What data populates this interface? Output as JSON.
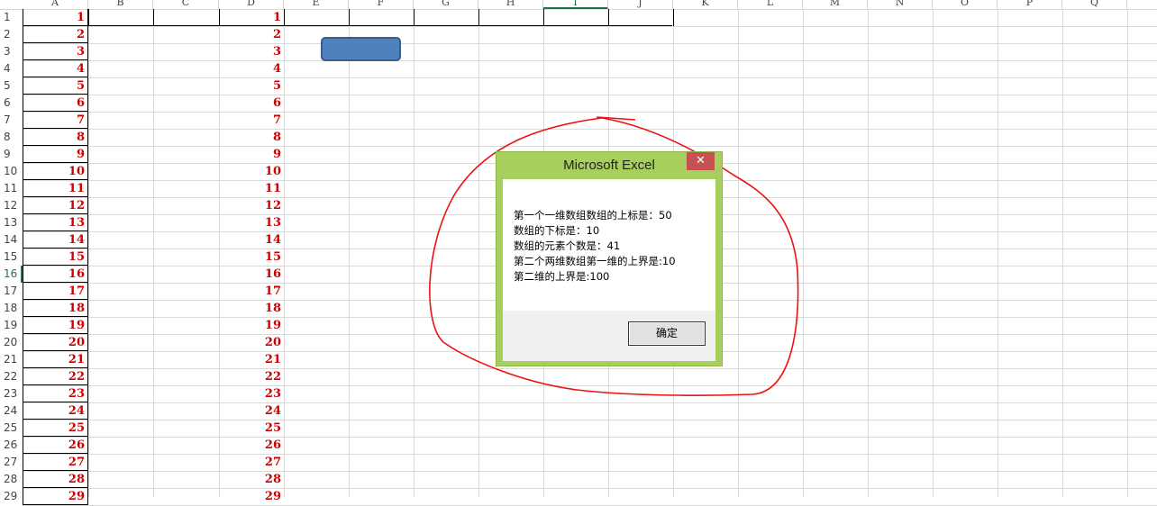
{
  "spreadsheet": {
    "columns": [
      "A",
      "B",
      "C",
      "D",
      "E",
      "F",
      "G",
      "H",
      "I",
      "J",
      "K",
      "L",
      "M",
      "N",
      "O",
      "P",
      "Q"
    ],
    "active_column": "I",
    "row_numbers": [
      "1",
      "2",
      "3",
      "4",
      "5",
      "6",
      "7",
      "8",
      "9",
      "10",
      "11",
      "12",
      "13",
      "14",
      "15",
      "16",
      "17",
      "18",
      "19",
      "20",
      "21",
      "22",
      "23",
      "24",
      "25",
      "26",
      "27",
      "28",
      "29"
    ],
    "active_row": "16",
    "column_a_values": [
      "1",
      "2",
      "3",
      "4",
      "5",
      "6",
      "7",
      "8",
      "9",
      "10",
      "11",
      "12",
      "13",
      "14",
      "15",
      "16",
      "17",
      "18",
      "19",
      "20",
      "21",
      "22",
      "23",
      "24",
      "25",
      "26",
      "27",
      "28",
      "29"
    ],
    "column_d_values": [
      "1",
      "2",
      "3",
      "4",
      "5",
      "6",
      "7",
      "8",
      "9",
      "10",
      "11",
      "12",
      "13",
      "14",
      "15",
      "16",
      "17",
      "18",
      "19",
      "20",
      "21",
      "22",
      "23",
      "24",
      "25",
      "26",
      "27",
      "28",
      "29"
    ],
    "value_color": "#cc0000"
  },
  "shape": {
    "fill_color": "#4f81bd"
  },
  "dialog": {
    "title": "Microsoft Excel",
    "close_icon": "close-icon",
    "close_glyph": "✕",
    "message_lines": [
      "第一个一维数组数组的上标是：50",
      "数组的下标是：10",
      "数组的元素个数是：41",
      "第二个两维数组第一维的上界是:10",
      "第二维的上界是:100"
    ],
    "ok_label": "确定",
    "title_bar_color": "#a7cf5d",
    "close_button_color": "#c75050"
  },
  "annotation": {
    "color": "#ee1111"
  }
}
